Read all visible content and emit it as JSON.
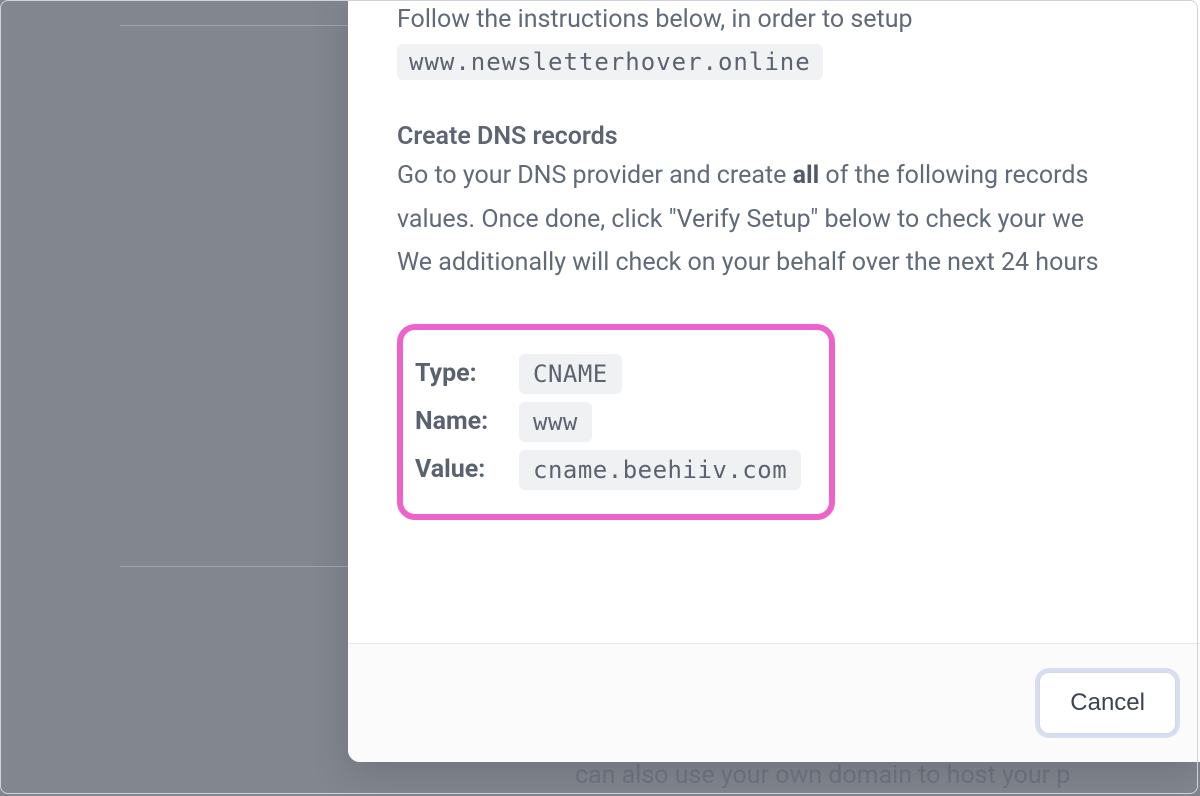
{
  "intro": {
    "lead_text": "Follow the instructions below, in order to setup",
    "domain_code": "www.newsletterhover.online"
  },
  "section": {
    "heading": "Create DNS records",
    "line1_pre": "Go to your DNS provider and create ",
    "line1_bold": "all",
    "line1_post": " of the following records",
    "line2": "values. Once done, click \"Verify Setup\" below to check your we",
    "line3": "We additionally will check on your behalf over the next 24 hours"
  },
  "dns": {
    "type_label": "Type:",
    "type_value": "CNAME",
    "name_label": "Name:",
    "name_value": "www",
    "value_label": "Value:",
    "value_value": "cname.beehiiv.com"
  },
  "footer": {
    "cancel_label": "Cancel"
  },
  "backdrop": {
    "hint_text": "can also use your own domain to host your p"
  }
}
